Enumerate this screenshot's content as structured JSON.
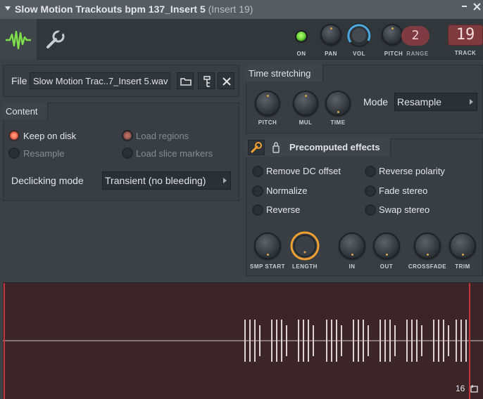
{
  "window": {
    "title": "Slow Motion Trackouts bpm 137_Insert 5",
    "subtitle": "(Insert 19)"
  },
  "toolbar": {
    "on_label": "ON",
    "pan_label": "PAN",
    "vol_label": "VOL",
    "pitch_label": "PITCH",
    "range_label": "RANGE",
    "range_value": "2",
    "track_label": "TRACK",
    "track_value": "19"
  },
  "file": {
    "label": "File",
    "value": "Slow Motion Trac..7_Insert 5.wav"
  },
  "content": {
    "title": "Content",
    "options": [
      {
        "label": "Keep on disk",
        "selected": true
      },
      {
        "label": "Load regions",
        "selected": true
      },
      {
        "label": "Resample",
        "selected": false
      },
      {
        "label": "Load slice markers",
        "selected": false
      }
    ],
    "declicking_label": "Declicking mode",
    "declicking_value": "Transient (no bleeding)"
  },
  "time_stretching": {
    "title": "Time stretching",
    "knobs": [
      "PITCH",
      "MUL",
      "TIME"
    ],
    "mode_label": "Mode",
    "mode_value": "Resample"
  },
  "precomputed": {
    "title": "Precomputed effects",
    "effects": [
      {
        "label": "Remove DC offset",
        "enabled": false
      },
      {
        "label": "Reverse polarity",
        "enabled": false
      },
      {
        "label": "Normalize",
        "enabled": false
      },
      {
        "label": "Fade stereo",
        "enabled": false
      },
      {
        "label": "Reverse",
        "enabled": false
      },
      {
        "label": "Swap stereo",
        "enabled": false
      }
    ],
    "knobs": [
      "SMP START",
      "LENGTH",
      "IN",
      "OUT",
      "CROSSFADE",
      "TRIM"
    ]
  },
  "waveform": {
    "zoom_value": "16"
  },
  "colors": {
    "accent_orange": "#f0a030",
    "vol_ring": "#4ea8e0",
    "led_green": "#7ee04a",
    "wave_bg": "#3b2529"
  }
}
